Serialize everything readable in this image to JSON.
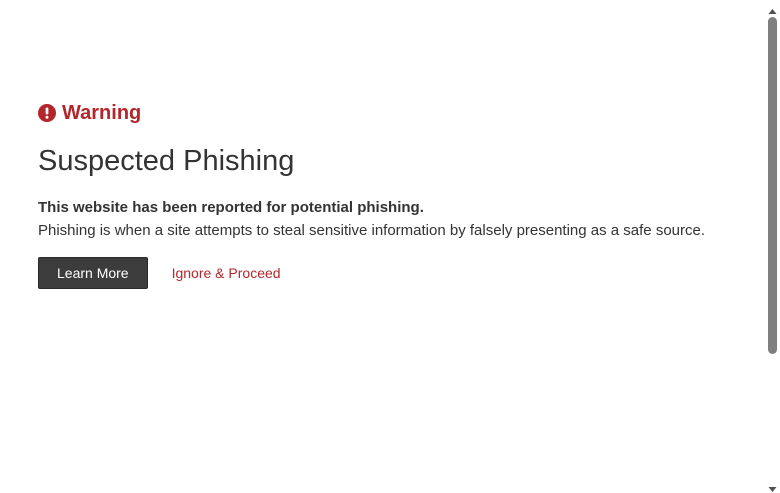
{
  "warning": {
    "icon": "exclamation-circle-icon",
    "label": "Warning",
    "color": "#b3262b"
  },
  "title": "Suspected Phishing",
  "description": {
    "strong": "This website has been reported for potential phishing.",
    "text": "Phishing is when a site attempts to steal sensitive information by falsely presenting as a safe source."
  },
  "actions": {
    "learn_more_label": "Learn More",
    "ignore_label": "Ignore & Proceed"
  },
  "scrollbar": {
    "up_icon": "triangle-up-icon",
    "down_icon": "triangle-down-icon"
  }
}
